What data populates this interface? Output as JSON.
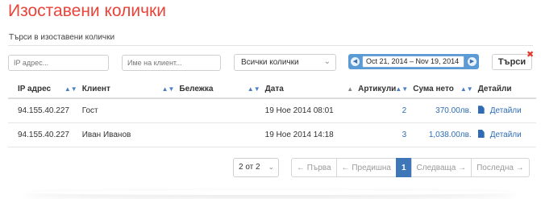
{
  "page": {
    "title": "Изоставени колички",
    "subtitle": "Търси в изоставени колички"
  },
  "filters": {
    "ip_placeholder": "IP адрес...",
    "client_placeholder": "Име на клиент...",
    "cart_select": "Всички колички",
    "date_range": "Oct 21, 2014 – Nov 19, 2014",
    "search_label": "Търси",
    "clear_icon": "close-icon"
  },
  "table": {
    "headers": [
      "IP адрес",
      "Клиент",
      "Бележка",
      "Дата",
      "Артикули",
      "Сума нето",
      "Детайли"
    ],
    "rows": [
      {
        "ip": "94.155.40.227",
        "client": "Гост",
        "note": "",
        "date": "19 Ное 2014 08:01",
        "items": "2",
        "amount": "370.00лв.",
        "details": "Детайли"
      },
      {
        "ip": "94.155.40.227",
        "client": "Иван Иванов",
        "note": "",
        "date": "19 Ное 2014 14:18",
        "items": "3",
        "amount": "1,038.00лв.",
        "details": "Детайли"
      }
    ]
  },
  "pagination": {
    "page_select": "2 от 2",
    "first": "← Първа",
    "prev": "← Предишна",
    "current": "1",
    "next": "Следваща →",
    "last": "Последна →"
  },
  "colors": {
    "title": "#e8443a",
    "accent": "#3f76b8",
    "link": "#2f6cb5"
  }
}
